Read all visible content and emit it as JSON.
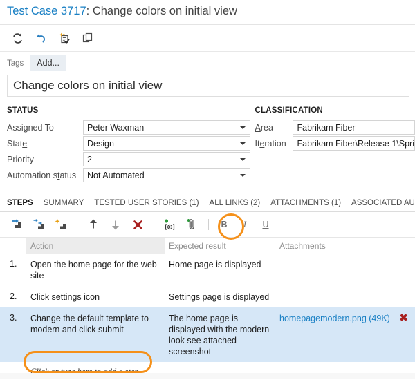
{
  "header": {
    "title_id": "Test Case 3717",
    "title_rest": ": Change colors on initial view"
  },
  "command_bar": {
    "buttons": [
      {
        "name": "refresh-icon",
        "tooltip": "Refresh"
      },
      {
        "name": "undo-icon",
        "tooltip": "Revert"
      },
      {
        "name": "new-linked-item-icon",
        "tooltip": "New linked work item"
      },
      {
        "name": "copy-icon",
        "tooltip": "Create copy of work item"
      }
    ]
  },
  "tags": {
    "label": "Tags",
    "add_label": "Add..."
  },
  "title_field": {
    "value": "Change colors on initial view"
  },
  "status": {
    "heading": "STATUS",
    "fields": [
      {
        "label": "Assigned To",
        "label_pre": "Assigned To",
        "label_ak": "",
        "label_post": "",
        "value": "Peter Waxman"
      },
      {
        "label": "State",
        "label_pre": "Stat",
        "label_ak": "e",
        "label_post": "",
        "value": "Design"
      },
      {
        "label": "Priority",
        "label_pre": "Priority",
        "label_ak": "",
        "label_post": "",
        "value": "2"
      },
      {
        "label": "Automation status",
        "label_pre": "Automation s",
        "label_ak": "t",
        "label_post": "atus",
        "value": "Not Automated"
      }
    ]
  },
  "classification": {
    "heading": "CLASSIFICATION",
    "fields": [
      {
        "label": "Area",
        "label_pre": "",
        "label_ak": "A",
        "label_post": "rea",
        "value": "Fabrikam Fiber"
      },
      {
        "label": "Iteration",
        "label_pre": "It",
        "label_ak": "e",
        "label_post": "ration",
        "value": "Fabrikam Fiber\\Release 1\\Spri"
      }
    ]
  },
  "tabs": [
    {
      "label": "STEPS",
      "active": true
    },
    {
      "label": "SUMMARY",
      "active": false
    },
    {
      "label": "TESTED USER STORIES (1)",
      "active": false
    },
    {
      "label": "ALL LINKS (2)",
      "active": false
    },
    {
      "label": "ATTACHMENTS (1)",
      "active": false
    },
    {
      "label": "ASSOCIATED AUTOMATION",
      "active": false
    }
  ],
  "steps_toolbar": {
    "buttons": [
      {
        "name": "insert-step-icon",
        "tooltip": "Insert step"
      },
      {
        "name": "insert-shared-steps-icon",
        "tooltip": "Insert shared steps"
      },
      {
        "name": "create-shared-steps-icon",
        "tooltip": "Create shared steps"
      },
      {
        "name": "move-up-icon",
        "tooltip": "Move step up"
      },
      {
        "name": "move-down-icon",
        "tooltip": "Move step down"
      },
      {
        "name": "delete-step-icon",
        "tooltip": "Delete step"
      },
      {
        "name": "insert-parameter-icon",
        "tooltip": "Insert parameter"
      },
      {
        "name": "attach-file-icon",
        "tooltip": "Attach file to step"
      }
    ],
    "format_buttons": [
      {
        "name": "bold-button",
        "label": "B"
      },
      {
        "name": "italic-button",
        "label": "I"
      },
      {
        "name": "underline-button",
        "label": "U"
      }
    ]
  },
  "steps_grid": {
    "columns": [
      "Action",
      "Expected result",
      "Attachments"
    ],
    "rows": [
      {
        "number": "1.",
        "action": "Open the home page for the web site",
        "expected": "Home page is displayed",
        "attachment": "",
        "attachment_size": "",
        "selected": false
      },
      {
        "number": "2.",
        "action": "Click settings icon",
        "expected": "Settings page is displayed",
        "attachment": "",
        "attachment_size": "",
        "selected": false
      },
      {
        "number": "3.",
        "action": "Change the default template to modern and click submit",
        "expected": "The home page is displayed with the modern look see attached screenshot",
        "attachment": "homepagemodern.png (49K)",
        "attachment_size": "49K",
        "selected": true
      }
    ],
    "add_step_placeholder": "Click or type here to add a step"
  },
  "annotations": {
    "highlight_color": "#f59019",
    "items": [
      {
        "name": "attach-file-highlight",
        "target": "attach-file-icon"
      },
      {
        "name": "add-step-highlight",
        "target": "add-step-row"
      }
    ]
  }
}
